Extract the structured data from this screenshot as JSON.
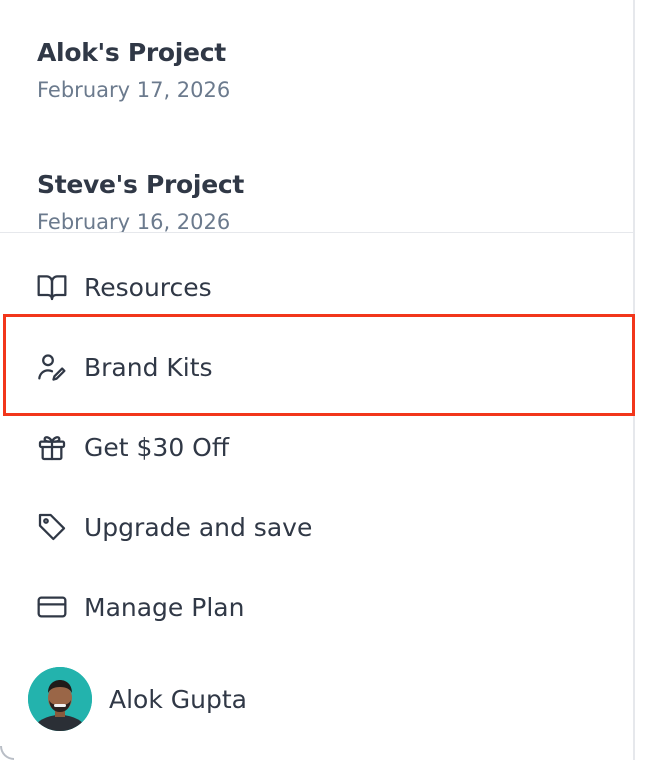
{
  "projects": [
    {
      "title": "Alok's Project",
      "date": "February 17, 2026"
    },
    {
      "title": "Steve's Project",
      "date": "February 16, 2026"
    }
  ],
  "menu": {
    "items": [
      {
        "label": "Resources",
        "icon": "book-open-icon"
      },
      {
        "label": "Brand Kits",
        "icon": "user-edit-icon"
      },
      {
        "label": "Get $30 Off",
        "icon": "gift-icon"
      },
      {
        "label": "Upgrade and save",
        "icon": "tag-icon"
      },
      {
        "label": "Manage Plan",
        "icon": "credit-card-icon"
      }
    ],
    "highlighted": "Brand Kits"
  },
  "user": {
    "name": "Alok Gupta"
  },
  "colors": {
    "text": "#303846",
    "muted": "#6b7a8d",
    "highlight": "#f2361b",
    "avatar_bg": "#23b3ad"
  }
}
